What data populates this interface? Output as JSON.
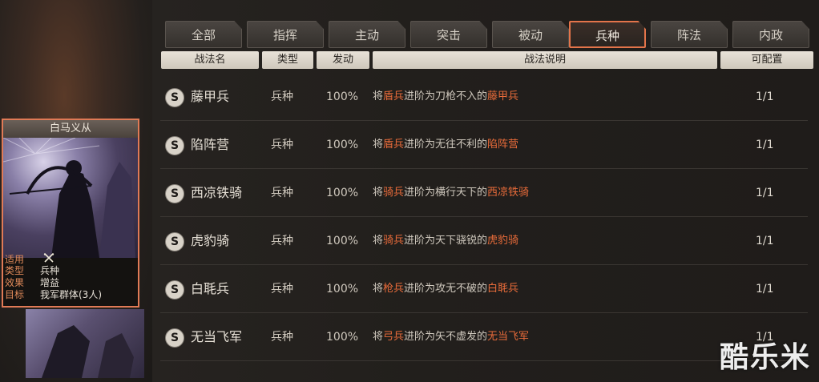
{
  "tabs": [
    {
      "label": "全部",
      "active": false
    },
    {
      "label": "指挥",
      "active": false
    },
    {
      "label": "主动",
      "active": false
    },
    {
      "label": "突击",
      "active": false
    },
    {
      "label": "被动",
      "active": false
    },
    {
      "label": "兵种",
      "active": true
    },
    {
      "label": "阵法",
      "active": false
    },
    {
      "label": "内政",
      "active": false
    }
  ],
  "table": {
    "headers": {
      "name": "战法名",
      "type": "类型",
      "rate": "发动",
      "desc": "战法说明",
      "cap": "可配置"
    },
    "rows": [
      {
        "grade": "S",
        "name": "藤甲兵",
        "type": "兵种",
        "rate": "100%",
        "desc": {
          "pre": "将",
          "unit": "盾兵",
          "mid": "进阶为刀枪不入的",
          "target": "藤甲兵"
        },
        "cap": "1/1"
      },
      {
        "grade": "S",
        "name": "陷阵营",
        "type": "兵种",
        "rate": "100%",
        "desc": {
          "pre": "将",
          "unit": "盾兵",
          "mid": "进阶为无往不利的",
          "target": "陷阵营"
        },
        "cap": "1/1"
      },
      {
        "grade": "S",
        "name": "西凉铁骑",
        "type": "兵种",
        "rate": "100%",
        "desc": {
          "pre": "将",
          "unit": "骑兵",
          "mid": "进阶为横行天下的",
          "target": "西凉铁骑"
        },
        "cap": "1/1"
      },
      {
        "grade": "S",
        "name": "虎豹骑",
        "type": "兵种",
        "rate": "100%",
        "desc": {
          "pre": "将",
          "unit": "骑兵",
          "mid": "进阶为天下骁锐的",
          "target": "虎豹骑"
        },
        "cap": "1/1"
      },
      {
        "grade": "S",
        "name": "白毦兵",
        "type": "兵种",
        "rate": "100%",
        "desc": {
          "pre": "将",
          "unit": "枪兵",
          "mid": "进阶为攻无不破的",
          "target": "白毦兵"
        },
        "cap": "1/1"
      },
      {
        "grade": "S",
        "name": "无当飞军",
        "type": "兵种",
        "rate": "100%",
        "desc": {
          "pre": "将",
          "unit": "弓兵",
          "mid": "进阶为矢不虚发的",
          "target": "无当飞军"
        },
        "cap": "1/1"
      }
    ]
  },
  "card": {
    "title": "白马义从",
    "info": [
      {
        "k": "适用",
        "v": "",
        "icon": "crossed-swords-icon"
      },
      {
        "k": "类型",
        "v": "兵种"
      },
      {
        "k": "效果",
        "v": "增益"
      },
      {
        "k": "目标",
        "v": "我军群体(3人)"
      }
    ]
  },
  "watermark": "酷乐米",
  "colors": {
    "accent": "#e3744a",
    "highlight": "#e86b3a",
    "label": "#e08a5a"
  }
}
